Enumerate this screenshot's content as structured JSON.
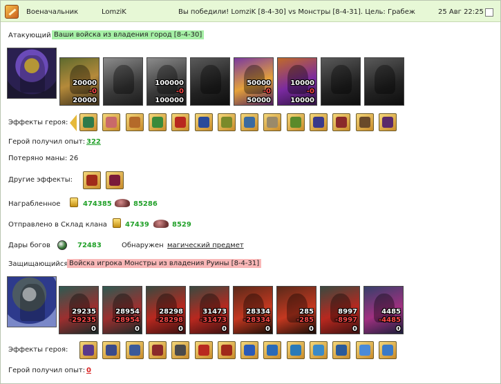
{
  "header": {
    "role": "Военачальник",
    "player": "LomziK",
    "result": "Вы победили! LomziK [8-4-30] vs Монстры [8-4-31]. Цель: Грабеж",
    "datetime": "25 Авг 22:25"
  },
  "attacker": {
    "label": "Атакующий",
    "army": "Ваши войска из владения город [8-4-30]",
    "units": [
      {
        "icon": "ogre-unit",
        "count": "20000",
        "lost": "-0",
        "remaining": "20000",
        "color": "olive"
      },
      {
        "icon": "dark-rider-unit",
        "count": "",
        "lost": "",
        "remaining": "",
        "color": "gray"
      },
      {
        "icon": "dragon-knight-unit",
        "count": "100000",
        "lost": "-0",
        "remaining": "100000",
        "color": "gray"
      },
      {
        "icon": "gargoyle-unit",
        "count": "",
        "lost": "",
        "remaining": "",
        "color": "dark"
      },
      {
        "icon": "archer-unit",
        "count": "50000",
        "lost": "-0",
        "remaining": "50000",
        "color": "violet"
      },
      {
        "icon": "mage-unit",
        "count": "10000",
        "lost": "-0",
        "remaining": "10000",
        "color": "purple"
      },
      {
        "icon": "crossed-blades-unit",
        "count": "",
        "lost": "",
        "remaining": "",
        "color": "dark"
      },
      {
        "icon": "spider-unit",
        "count": "",
        "lost": "",
        "remaining": "",
        "color": "dark"
      }
    ],
    "hero_effects_label": "Эффекты героя:",
    "effects": [
      {
        "icon": "shield-effect-icon",
        "color": "#2f7a4a"
      },
      {
        "icon": "heart-effect-icon",
        "color": "#c96a6a"
      },
      {
        "icon": "scroll-effect-icon",
        "color": "#b46a2a"
      },
      {
        "icon": "sword-effect-icon",
        "color": "#3a8a3a"
      },
      {
        "icon": "flame-effect-icon",
        "color": "#b8281f"
      },
      {
        "icon": "star-effect-icon",
        "color": "#2a4a9a"
      },
      {
        "icon": "gauntlet-effect-icon",
        "color": "#7a8a2a"
      },
      {
        "icon": "horseshoe-effect-icon",
        "color": "#3a6aa0"
      },
      {
        "icon": "bone-effect-icon",
        "color": "#9a8a6a"
      },
      {
        "icon": "staff-effect-icon",
        "color": "#5a8a2a"
      },
      {
        "icon": "armor-effect-icon",
        "color": "#3a3a8a"
      },
      {
        "icon": "axe-effect-icon",
        "color": "#8a2a2a"
      },
      {
        "icon": "boots-effect-icon",
        "color": "#6a4a2a"
      },
      {
        "icon": "banner-effect-icon",
        "color": "#5a2a6a"
      }
    ],
    "xp_label": "Герой получил опыт:",
    "xp_value": "322",
    "mana_text": "Потеряно маны: 26",
    "other_effects_label": "Другие эффекты:",
    "other_effects": [
      {
        "icon": "dagger-effect-icon",
        "color": "#a02a1a"
      },
      {
        "icon": "potion-effect-icon",
        "color": "#7a1a3a"
      }
    ],
    "loot_label": "Награбленное",
    "loot_gold": "474385",
    "loot_ore": "85286",
    "clan_label": "Отправлено в Склад клана",
    "clan_gold": "47439",
    "clan_ore": "8529",
    "gifts_label": "Дары богов",
    "gifts_value": "72483",
    "found_label": "Обнаружен",
    "found_item": "магический предмет"
  },
  "defender": {
    "label": "Защищающийся",
    "army": "Войска игрока Монстры из владения Руины [8-4-31]",
    "units": [
      {
        "icon": "lizard-warrior-unit",
        "count": "29235",
        "lost": "-29235",
        "remaining": "0",
        "color": "teal"
      },
      {
        "icon": "black-knight-unit",
        "count": "28954",
        "lost": "-28954",
        "remaining": "0",
        "color": "teal"
      },
      {
        "icon": "orc-chieftain-unit",
        "count": "28298",
        "lost": "-28298",
        "remaining": "0",
        "color": "red"
      },
      {
        "icon": "red-demon-unit",
        "count": "31473",
        "lost": "-31473",
        "remaining": "0",
        "color": "red"
      },
      {
        "icon": "claw-beast-unit",
        "count": "28334",
        "lost": "-28334",
        "remaining": "0",
        "color": "lava"
      },
      {
        "icon": "horned-devil-unit",
        "count": "285",
        "lost": "-285",
        "remaining": "0",
        "color": "lava"
      },
      {
        "icon": "stone-golem-unit",
        "count": "8997",
        "lost": "-8997",
        "remaining": "0",
        "color": "red"
      },
      {
        "icon": "blade-demon-unit",
        "count": "4485",
        "lost": "-4485",
        "remaining": "0",
        "color": "blue"
      }
    ],
    "hero_effects_label": "Эффекты героя:",
    "effects": [
      {
        "icon": "helmet-effect-icon",
        "color": "#5a3a8a"
      },
      {
        "icon": "arrows-effect-icon",
        "color": "#3a4a8a"
      },
      {
        "icon": "shield-effect-icon",
        "color": "#3a5a9a"
      },
      {
        "icon": "skull-effect-icon",
        "color": "#8a2a2a"
      },
      {
        "icon": "pillar-effect-icon",
        "color": "#4a4a4a"
      },
      {
        "icon": "hammer-effect-icon",
        "color": "#b8281f"
      },
      {
        "icon": "beast-effect-icon",
        "color": "#a02a1a"
      },
      {
        "icon": "snowflake-effect-icon",
        "color": "#2a5ab8"
      },
      {
        "icon": "frost-shield-effect-icon",
        "color": "#2a6ab8"
      },
      {
        "icon": "ring-effect-icon",
        "color": "#2a7ab8"
      },
      {
        "icon": "ice-sword-effect-icon",
        "color": "#3a8ac8"
      },
      {
        "icon": "ice-axe-effect-icon",
        "color": "#2a5a9a"
      },
      {
        "icon": "ice-star-effect-icon",
        "color": "#4a8ad8"
      },
      {
        "icon": "question-effect-icon",
        "color": "#3a7ac8"
      }
    ],
    "xp_label": "Герой получил опыт:",
    "xp_value": "0"
  }
}
